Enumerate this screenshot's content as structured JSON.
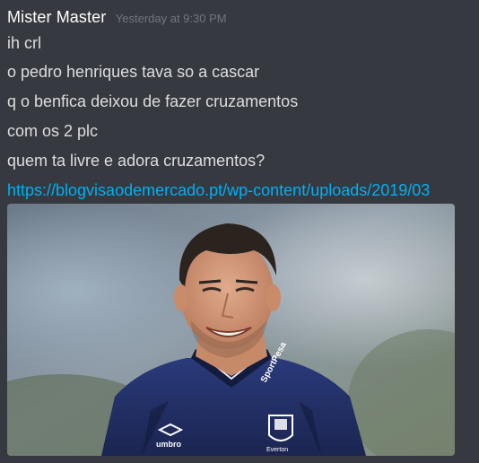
{
  "message": {
    "username": "Mister Master",
    "timestamp": "Yesterday at 9:30 PM",
    "lines": [
      "ih crl",
      "o pedro henriques tava so a cascar",
      "q o benfica deixou de fazer cruzamentos",
      "com os 2 plc",
      "quem ta livre e adora cruzamentos?"
    ],
    "link": "https://blogvisaodemercado.pt/wp-content/uploads/2019/03",
    "embed_image": {
      "description_icon": "photo-of-smiling-man-in-sports-jacket",
      "shirt_text": "SportPesa",
      "badge_text": "Everton",
      "brand_text": "umbro"
    }
  },
  "colors": {
    "background": "#36393f",
    "username": "#ffffff",
    "timestamp": "#72767d",
    "text": "#dcddde",
    "link": "#00b0f4"
  }
}
